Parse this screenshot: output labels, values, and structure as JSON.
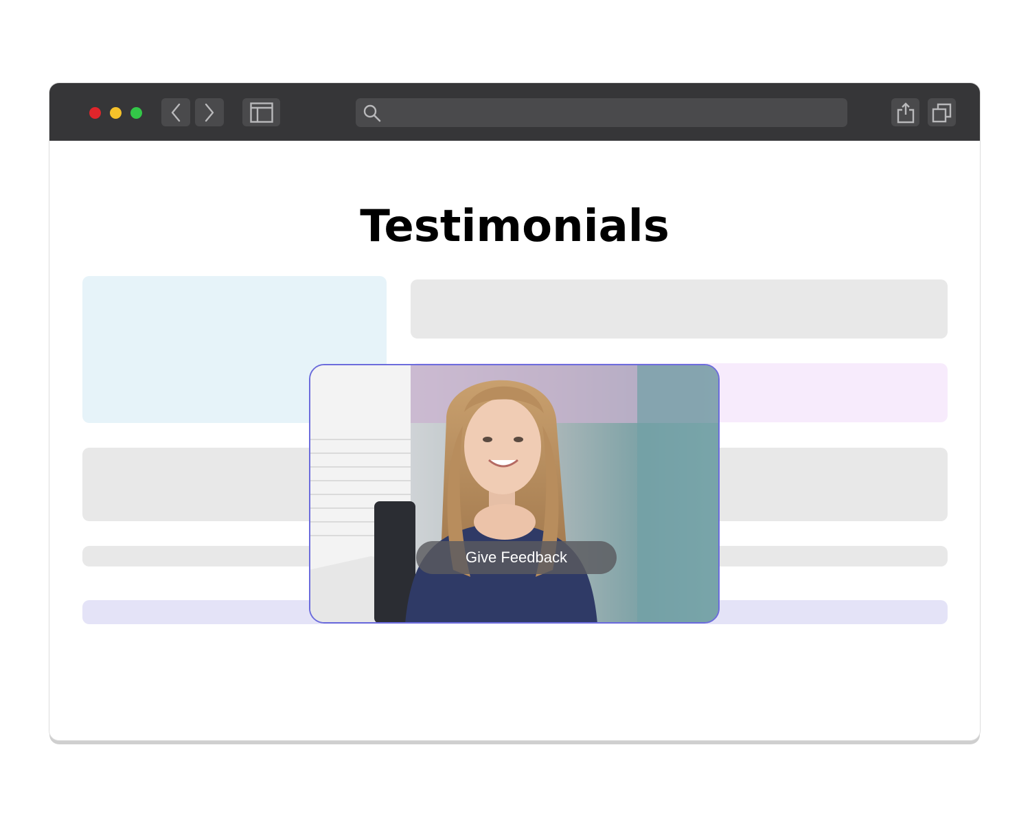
{
  "page": {
    "title": "Testimonials"
  },
  "browser": {
    "url": "",
    "icons": [
      "close-dot",
      "minimize-dot",
      "maximize-dot",
      "back-chevron-icon",
      "forward-chevron-icon",
      "sidebar-icon",
      "search-icon",
      "share-icon",
      "tabs-icon"
    ]
  },
  "video_card": {
    "button_label": "Give Feedback",
    "border_color": "#6b6bdc"
  },
  "colors": {
    "toolbar": "#363638",
    "placeholder_gray": "#e8e8e8",
    "placeholder_blue": "#e6f3f9",
    "placeholder_pink": "#f7ebfc",
    "placeholder_lavender": "#e4e3f7"
  }
}
